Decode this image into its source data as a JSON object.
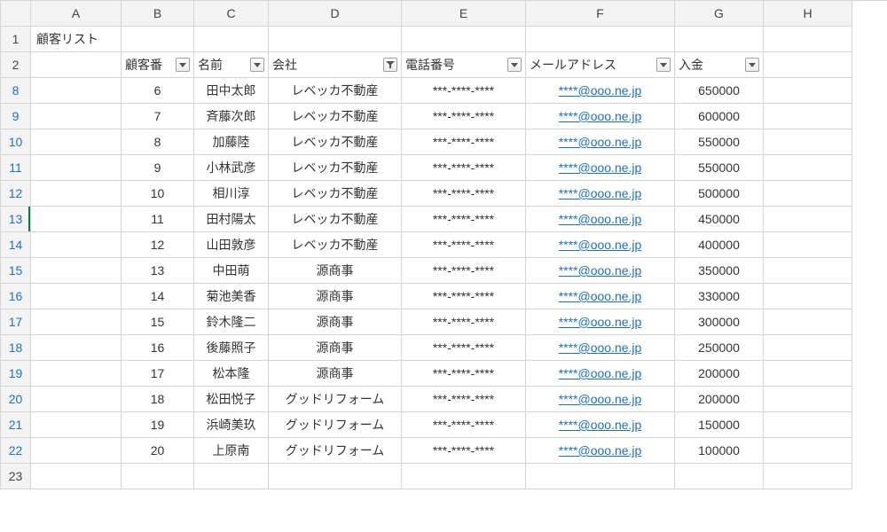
{
  "columns": [
    "A",
    "B",
    "C",
    "D",
    "E",
    "F",
    "G",
    "H"
  ],
  "title_cell": "顧客リスト",
  "header_row_number": "2",
  "headers": {
    "B": {
      "label": "顧客番",
      "filtered": false
    },
    "C": {
      "label": "名前",
      "filtered": false
    },
    "D": {
      "label": "会社",
      "filtered": true
    },
    "E": {
      "label": "電話番号",
      "filtered": false
    },
    "F": {
      "label": "メールアドレス",
      "filtered": false
    },
    "G": {
      "label": "入金",
      "filtered": false
    }
  },
  "chart_data": {
    "type": "table",
    "columns": [
      "顧客番",
      "名前",
      "会社",
      "電話番号",
      "メールアドレス",
      "入金"
    ],
    "rows": [
      [
        6,
        "田中太郎",
        "レベッカ不動産",
        "***-****-****",
        "****@ooo.ne.jp",
        650000
      ],
      [
        7,
        "斉藤次郎",
        "レベッカ不動産",
        "***-****-****",
        "****@ooo.ne.jp",
        600000
      ],
      [
        8,
        "加藤陸",
        "レベッカ不動産",
        "***-****-****",
        "****@ooo.ne.jp",
        550000
      ],
      [
        9,
        "小林武彦",
        "レベッカ不動産",
        "***-****-****",
        "****@ooo.ne.jp",
        550000
      ],
      [
        10,
        "相川淳",
        "レベッカ不動産",
        "***-****-****",
        "****@ooo.ne.jp",
        500000
      ],
      [
        11,
        "田村陽太",
        "レベッカ不動産",
        "***-****-****",
        "****@ooo.ne.jp",
        450000
      ],
      [
        12,
        "山田敦彦",
        "レベッカ不動産",
        "***-****-****",
        "****@ooo.ne.jp",
        400000
      ],
      [
        13,
        "中田萌",
        "源商事",
        "***-****-****",
        "****@ooo.ne.jp",
        350000
      ],
      [
        14,
        "菊池美香",
        "源商事",
        "***-****-****",
        "****@ooo.ne.jp",
        330000
      ],
      [
        15,
        "鈴木隆二",
        "源商事",
        "***-****-****",
        "****@ooo.ne.jp",
        300000
      ],
      [
        16,
        "後藤照子",
        "源商事",
        "***-****-****",
        "****@ooo.ne.jp",
        250000
      ],
      [
        17,
        "松本隆",
        "源商事",
        "***-****-****",
        "****@ooo.ne.jp",
        200000
      ],
      [
        18,
        "松田悦子",
        "グッドリフォーム",
        "***-****-****",
        "****@ooo.ne.jp",
        200000
      ],
      [
        19,
        "浜崎美玖",
        "グッドリフォーム",
        "***-****-****",
        "****@ooo.ne.jp",
        150000
      ],
      [
        20,
        "上原南",
        "グッドリフォーム",
        "***-****-****",
        "****@ooo.ne.jp",
        100000
      ]
    ]
  },
  "row_numbers": [
    "1",
    "2",
    "8",
    "9",
    "10",
    "11",
    "12",
    "13",
    "14",
    "15",
    "16",
    "17",
    "18",
    "19",
    "20",
    "21",
    "22",
    "23"
  ],
  "filtered_row_numbers": [
    "8",
    "9",
    "10",
    "11",
    "12",
    "13",
    "14",
    "15",
    "16",
    "17",
    "18",
    "19",
    "20",
    "21",
    "22"
  ],
  "active_row": "13",
  "trailing_empty_row": "23"
}
